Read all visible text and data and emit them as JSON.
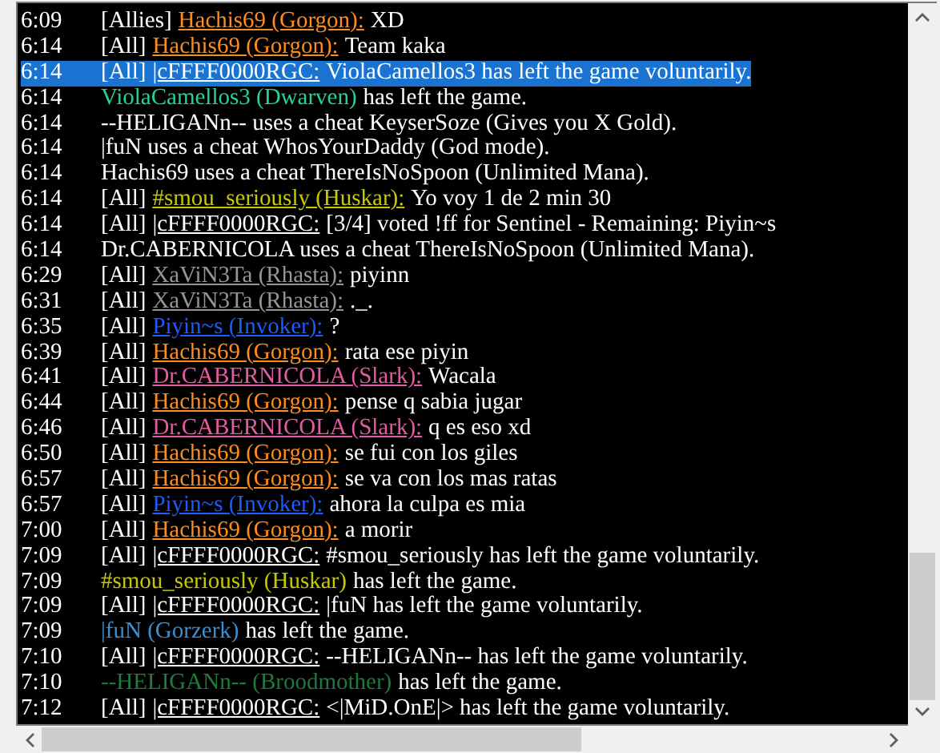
{
  "chat_log": [
    {
      "time": "6:09",
      "selected": false,
      "kind": "chat",
      "channel": "[Allies]",
      "speaker": "Hachis69 (Gorgon):",
      "color": "#ff8c1a",
      "text": "XD"
    },
    {
      "time": "6:14",
      "selected": false,
      "kind": "chat",
      "channel": "[All]",
      "speaker": "Hachis69 (Gorgon):",
      "color": "#ff8c1a",
      "text": "Team kaka"
    },
    {
      "time": "6:14",
      "selected": true,
      "kind": "chat",
      "channel": "[All]",
      "speaker": "|cFFFF0000RGC:",
      "text": "ViolaCamellos3 has left the game voluntarily."
    },
    {
      "time": "6:14",
      "selected": false,
      "kind": "event",
      "speaker": "ViolaCamellos3 (Dwarven)",
      "color": "#26d395",
      "text": "has left the game."
    },
    {
      "time": "6:14",
      "selected": false,
      "kind": "notice",
      "text": "--HELIGANn-- uses a cheat KeyserSoze (Gives you X Gold)."
    },
    {
      "time": "6:14",
      "selected": false,
      "kind": "notice",
      "text": "|fuN uses a cheat WhosYourDaddy (God mode)."
    },
    {
      "time": "6:14",
      "selected": false,
      "kind": "notice",
      "text": "Hachis69 uses a cheat ThereIsNoSpoon (Unlimited Mana)."
    },
    {
      "time": "6:14",
      "selected": false,
      "kind": "chat",
      "channel": "[All]",
      "speaker": "#smou_seriously (Huskar):",
      "color": "#c8c800",
      "text": "Yo voy 1 de 2 min 30"
    },
    {
      "time": "6:14",
      "selected": false,
      "kind": "chat",
      "channel": "[All]",
      "speaker": "|cFFFF0000RGC:",
      "text": "[3/4] voted !ff for Sentinel - Remaining: Piyin~s"
    },
    {
      "time": "6:14",
      "selected": false,
      "kind": "notice",
      "text": "Dr.CABERNICOLA uses a cheat ThereIsNoSpoon (Unlimited Mana)."
    },
    {
      "time": "6:29",
      "selected": false,
      "kind": "chat",
      "channel": "[All]",
      "speaker": "XaViN3Ta (Rhasta):",
      "color": "#959595",
      "text": "piyinn"
    },
    {
      "time": "6:31",
      "selected": false,
      "kind": "chat",
      "channel": "[All]",
      "speaker": "XaViN3Ta (Rhasta):",
      "color": "#959595",
      "text": "._."
    },
    {
      "time": "6:35",
      "selected": false,
      "kind": "chat",
      "channel": "[All]",
      "speaker": "Piyin~s (Invoker):",
      "color": "#1a5cff",
      "text": "?"
    },
    {
      "time": "6:39",
      "selected": false,
      "kind": "chat",
      "channel": "[All]",
      "speaker": "Hachis69 (Gorgon):",
      "color": "#ff8c1a",
      "text": "rata ese piyin"
    },
    {
      "time": "6:41",
      "selected": false,
      "kind": "chat",
      "channel": "[All]",
      "speaker": "Dr.CABERNICOLA (Slark):",
      "color": "#e55ba3",
      "text": "Wacala"
    },
    {
      "time": "6:44",
      "selected": false,
      "kind": "chat",
      "channel": "[All]",
      "speaker": "Hachis69 (Gorgon):",
      "color": "#ff8c1a",
      "text": "pense q sabia jugar"
    },
    {
      "time": "6:46",
      "selected": false,
      "kind": "chat",
      "channel": "[All]",
      "speaker": "Dr.CABERNICOLA (Slark):",
      "color": "#e55ba3",
      "text": "q es eso xd"
    },
    {
      "time": "6:50",
      "selected": false,
      "kind": "chat",
      "channel": "[All]",
      "speaker": "Hachis69 (Gorgon):",
      "color": "#ff8c1a",
      "text": "se fui con los giles"
    },
    {
      "time": "6:57",
      "selected": false,
      "kind": "chat",
      "channel": "[All]",
      "speaker": "Hachis69 (Gorgon):",
      "color": "#ff8c1a",
      "text": "se va con los mas ratas"
    },
    {
      "time": "6:57",
      "selected": false,
      "kind": "chat",
      "channel": "[All]",
      "speaker": "Piyin~s (Invoker):",
      "color": "#1a5cff",
      "text": "ahora la culpa es mia"
    },
    {
      "time": "7:00",
      "selected": false,
      "kind": "chat",
      "channel": "[All]",
      "speaker": "Hachis69 (Gorgon):",
      "color": "#ff8c1a",
      "text": "a morir"
    },
    {
      "time": "7:09",
      "selected": false,
      "kind": "chat",
      "channel": "[All]",
      "speaker": "|cFFFF0000RGC:",
      "text": "#smou_seriously has left the game voluntarily."
    },
    {
      "time": "7:09",
      "selected": false,
      "kind": "event",
      "speaker": "#smou_seriously (Huskar)",
      "color": "#c8c800",
      "text": "has left the game."
    },
    {
      "time": "7:09",
      "selected": false,
      "kind": "chat",
      "channel": "[All]",
      "speaker": "|cFFFF0000RGC:",
      "text": "|fuN has left the game voluntarily."
    },
    {
      "time": "7:09",
      "selected": false,
      "kind": "event",
      "speaker": "|fuN (Gorzerk)",
      "color": "#3a8fd0",
      "text": "has left the game."
    },
    {
      "time": "7:10",
      "selected": false,
      "kind": "chat",
      "channel": "[All]",
      "speaker": "|cFFFF0000RGC:",
      "text": "--HELIGANn-- has left the game voluntarily."
    },
    {
      "time": "7:10",
      "selected": false,
      "kind": "event",
      "speaker": "--HELIGANn-- (Broodmother)",
      "color": "#1f7a3d",
      "text": "has left the game."
    },
    {
      "time": "7:12",
      "selected": false,
      "kind": "chat",
      "channel": "[All]",
      "speaker": "|cFFFF0000RGC:",
      "text": "<|MiD.OnE|> has left the game voluntarily."
    }
  ]
}
